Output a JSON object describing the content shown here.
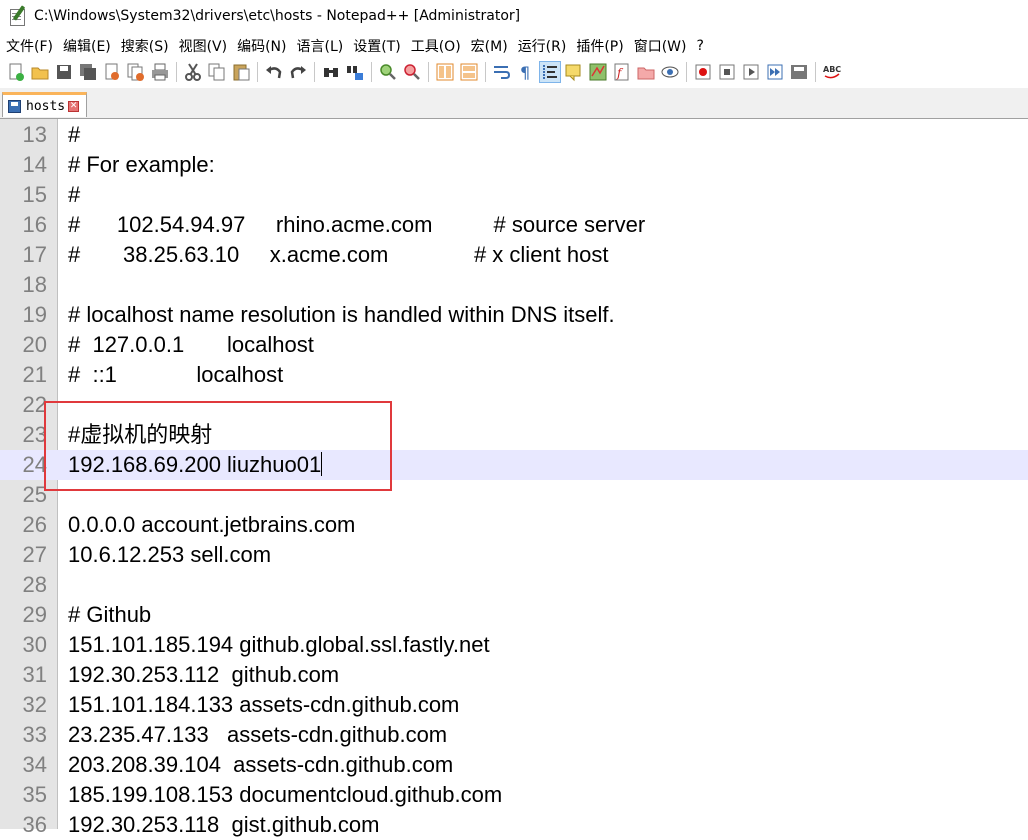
{
  "window": {
    "title": "C:\\Windows\\System32\\drivers\\etc\\hosts - Notepad++ [Administrator]"
  },
  "menu": [
    "文件(F)",
    "编辑(E)",
    "搜索(S)",
    "视图(V)",
    "编码(N)",
    "语言(L)",
    "设置(T)",
    "工具(O)",
    "宏(M)",
    "运行(R)",
    "插件(P)",
    "窗口(W)",
    "?"
  ],
  "tab": {
    "label": "hosts",
    "close_glyph": "✕"
  },
  "editor": {
    "current_line": 24,
    "lines": [
      {
        "num": "13",
        "text": "#"
      },
      {
        "num": "14",
        "text": "# For example:"
      },
      {
        "num": "15",
        "text": "#"
      },
      {
        "num": "16",
        "text": "#      102.54.94.97     rhino.acme.com          # source server"
      },
      {
        "num": "17",
        "text": "#       38.25.63.10     x.acme.com              # x client host"
      },
      {
        "num": "18",
        "text": ""
      },
      {
        "num": "19",
        "text": "# localhost name resolution is handled within DNS itself."
      },
      {
        "num": "20",
        "text": "#  127.0.0.1       localhost"
      },
      {
        "num": "21",
        "text": "#  ::1             localhost"
      },
      {
        "num": "22",
        "text": ""
      },
      {
        "num": "23",
        "text": "#虚拟机的映射"
      },
      {
        "num": "24",
        "text": "192.168.69.200 liuzhuo01"
      },
      {
        "num": "25",
        "text": ""
      },
      {
        "num": "26",
        "text": "0.0.0.0 account.jetbrains.com"
      },
      {
        "num": "27",
        "text": "10.6.12.253 sell.com"
      },
      {
        "num": "28",
        "text": ""
      },
      {
        "num": "29",
        "text": "# Github"
      },
      {
        "num": "30",
        "text": "151.101.185.194 github.global.ssl.fastly.net"
      },
      {
        "num": "31",
        "text": "192.30.253.112  github.com"
      },
      {
        "num": "32",
        "text": "151.101.184.133 assets-cdn.github.com"
      },
      {
        "num": "33",
        "text": "23.235.47.133   assets-cdn.github.com"
      },
      {
        "num": "34",
        "text": "203.208.39.104  assets-cdn.github.com"
      },
      {
        "num": "35",
        "text": "185.199.108.153 documentcloud.github.com"
      },
      {
        "num": "36",
        "text": "192.30.253.118  gist.github.com"
      }
    ]
  },
  "toolbar_icons": [
    "new-file-icon",
    "open-file-icon",
    "save-icon",
    "save-all-icon",
    "close-icon",
    "close-all-icon",
    "print-icon",
    "cut-icon",
    "copy-icon",
    "paste-icon",
    "undo-icon",
    "redo-icon",
    "find-icon",
    "replace-icon",
    "zoom-in-icon",
    "zoom-out-icon",
    "sync-vertical-icon",
    "sync-horizontal-icon",
    "word-wrap-icon",
    "show-all-chars-icon",
    "indent-guide-icon",
    "udl-icon",
    "doc-map-icon",
    "function-list-icon",
    "folder-workspace-icon",
    "monitoring-icon",
    "record-macro-icon",
    "stop-macro-icon",
    "play-macro-icon",
    "run-macro-multiple-icon",
    "save-macro-icon",
    "spellcheck-icon"
  ],
  "colors": {
    "gutter_bg": "#e4e4e4",
    "current_line_bg": "#e8e8ff",
    "annotation_box": "#e0393c",
    "tab_accent": "#fab45a"
  }
}
